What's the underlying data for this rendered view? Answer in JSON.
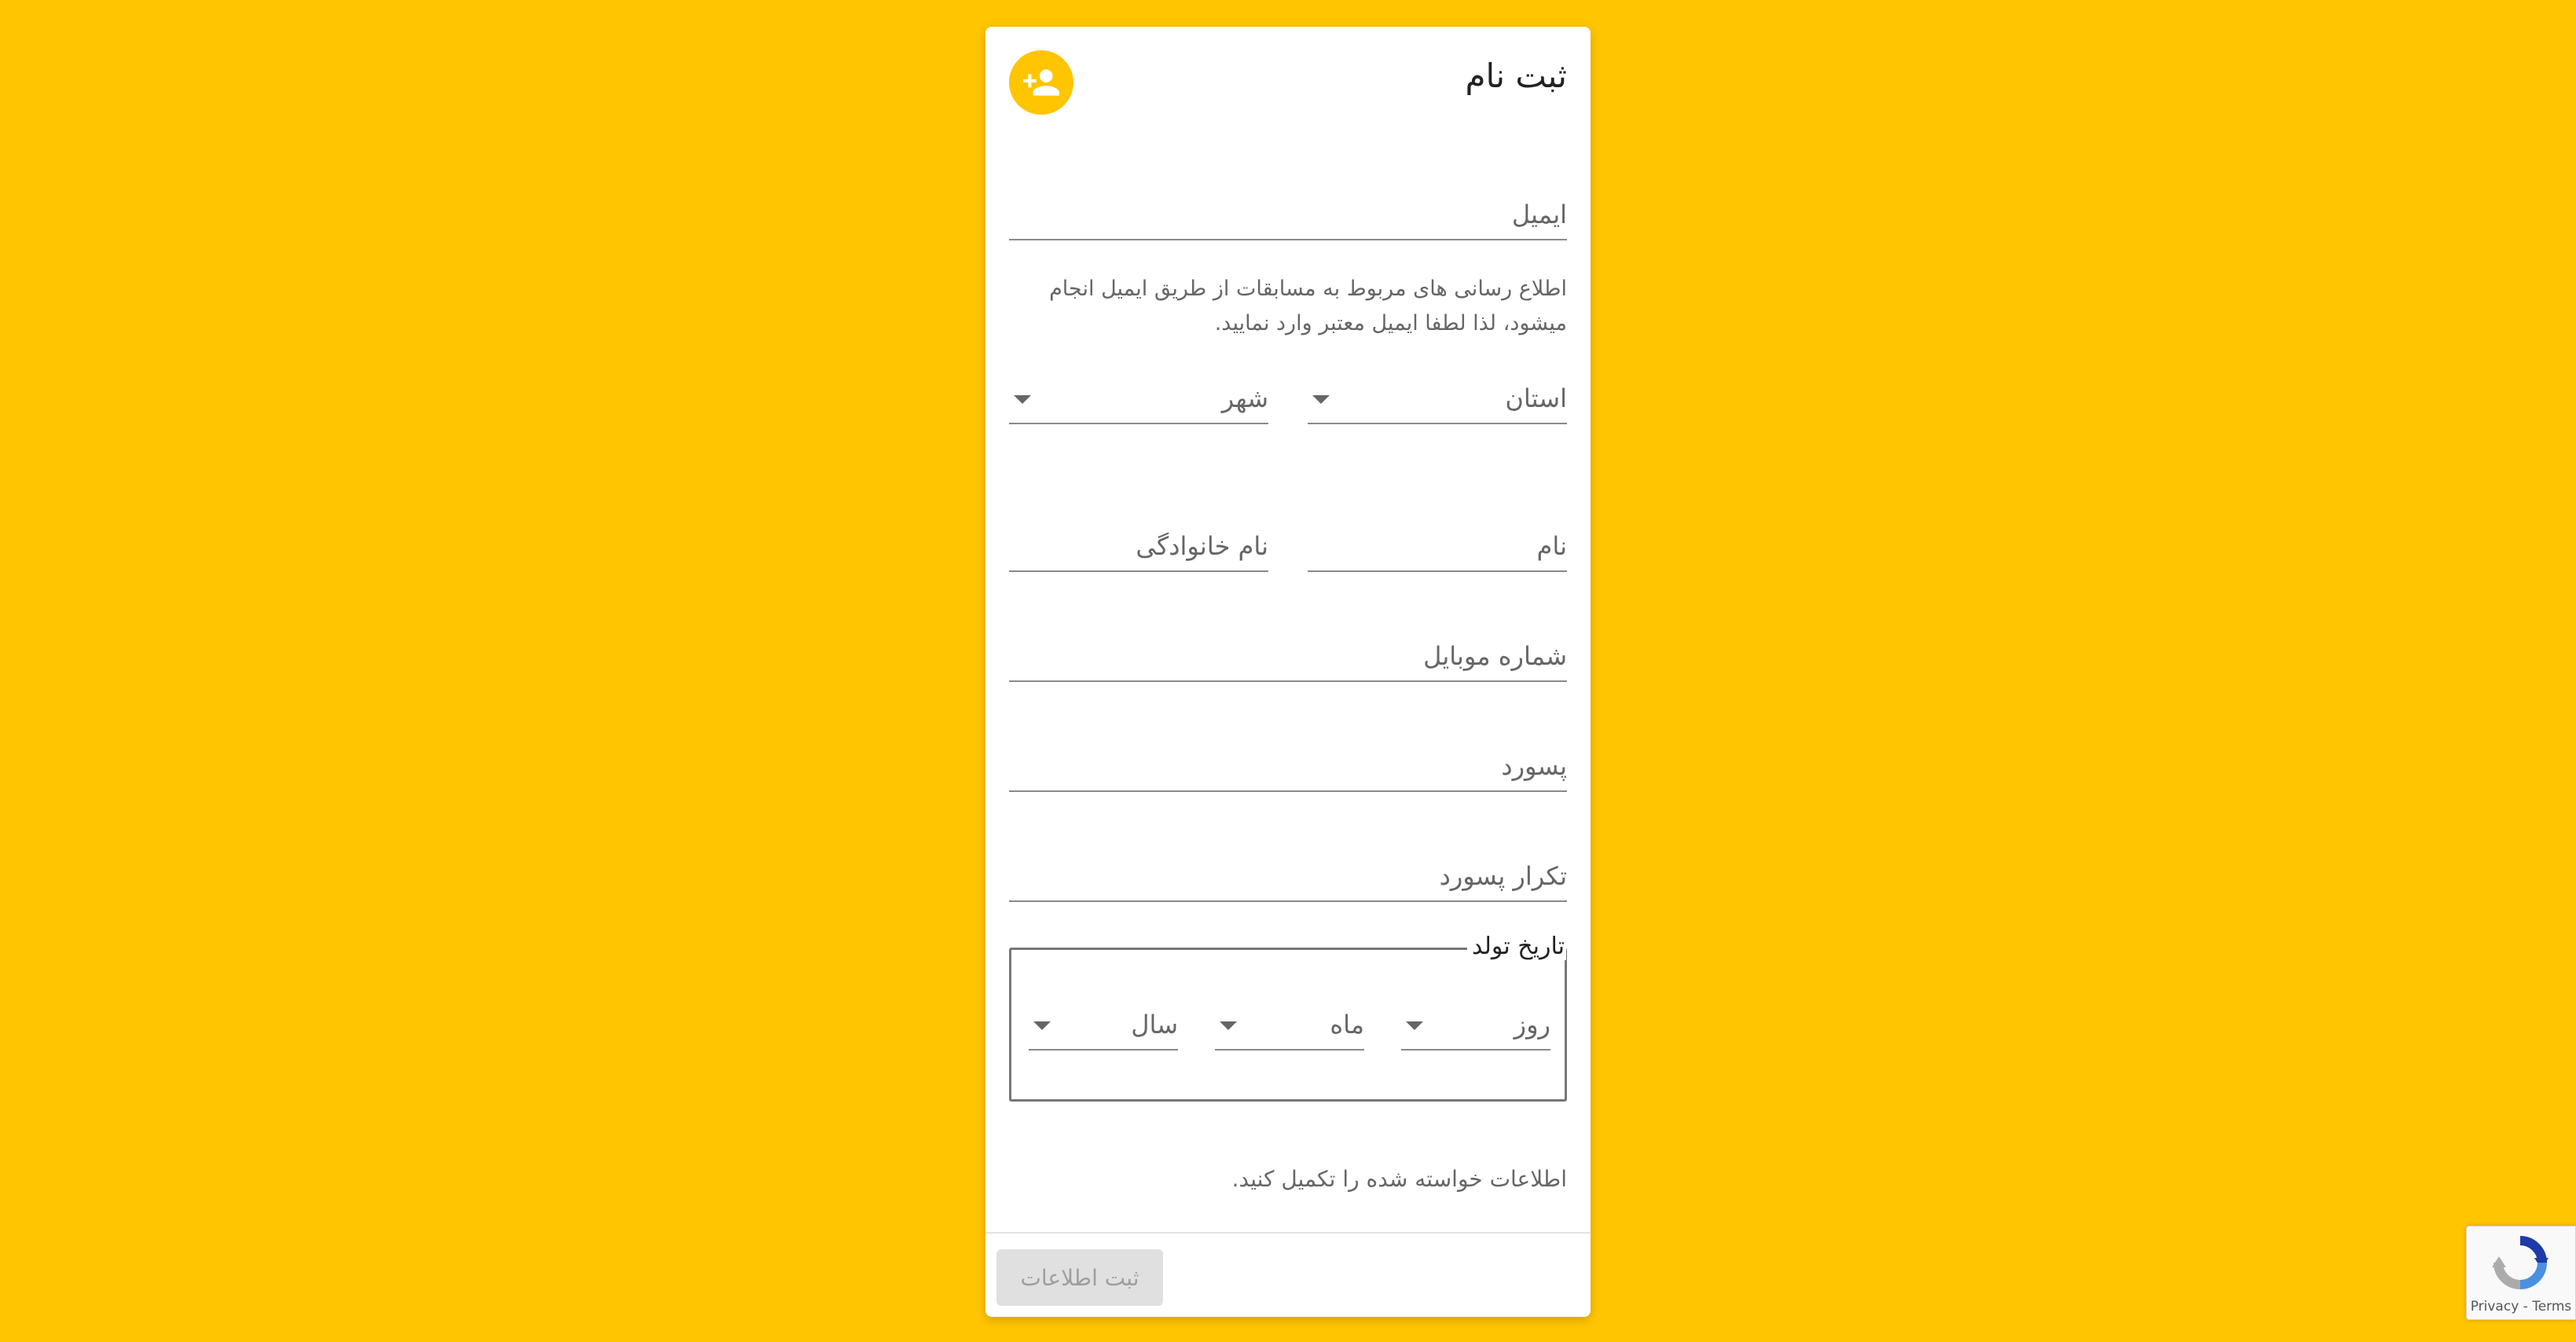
{
  "header": {
    "title": "ثبت نام",
    "icon": "person-add-icon"
  },
  "form": {
    "email_label": "ایمیل",
    "email_helper": "اطلاع رسانی های مربوط به مسابقات از طریق ایمیل انجام میشود، لذا لطفا ایمیل معتبر وارد نمایید.",
    "province_label": "استان",
    "city_label": "شهر",
    "first_name_label": "نام",
    "last_name_label": "نام خانوادگی",
    "mobile_label": "شماره موبایل",
    "password_label": "پسورد",
    "password_repeat_label": "تکرار پسورد",
    "birthdate": {
      "legend": "تاریخ تولد",
      "day_label": "روز",
      "month_label": "ماه",
      "year_label": "سال"
    },
    "status_text": "اطلاعات خواسته شده را تکمیل کنید.",
    "submit_label": "ثبت اطلاعات"
  },
  "recaptcha": {
    "privacy": "Privacy",
    "separator": "-",
    "terms": "Terms"
  },
  "colors": {
    "background": "#FFC500",
    "card": "#FFFFFF",
    "button_disabled": "#E0E0E0"
  }
}
